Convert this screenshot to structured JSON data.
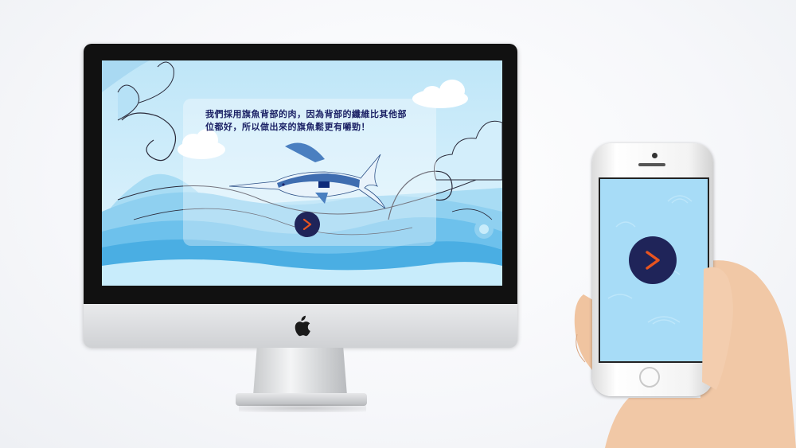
{
  "screen": {
    "message": "我們採用旗魚背部的肉，因為背部的纖維比其他部位都好，所以做出來的旗魚鬆更有嚼勁！"
  },
  "icons": {
    "next": "chevron-right-icon",
    "brand": "apple-logo-icon"
  },
  "colors": {
    "button_bg": "#1f2459",
    "arrow": "#e8541f",
    "sky": "#cfeefb",
    "phone_screen": "#a7dcf7"
  }
}
